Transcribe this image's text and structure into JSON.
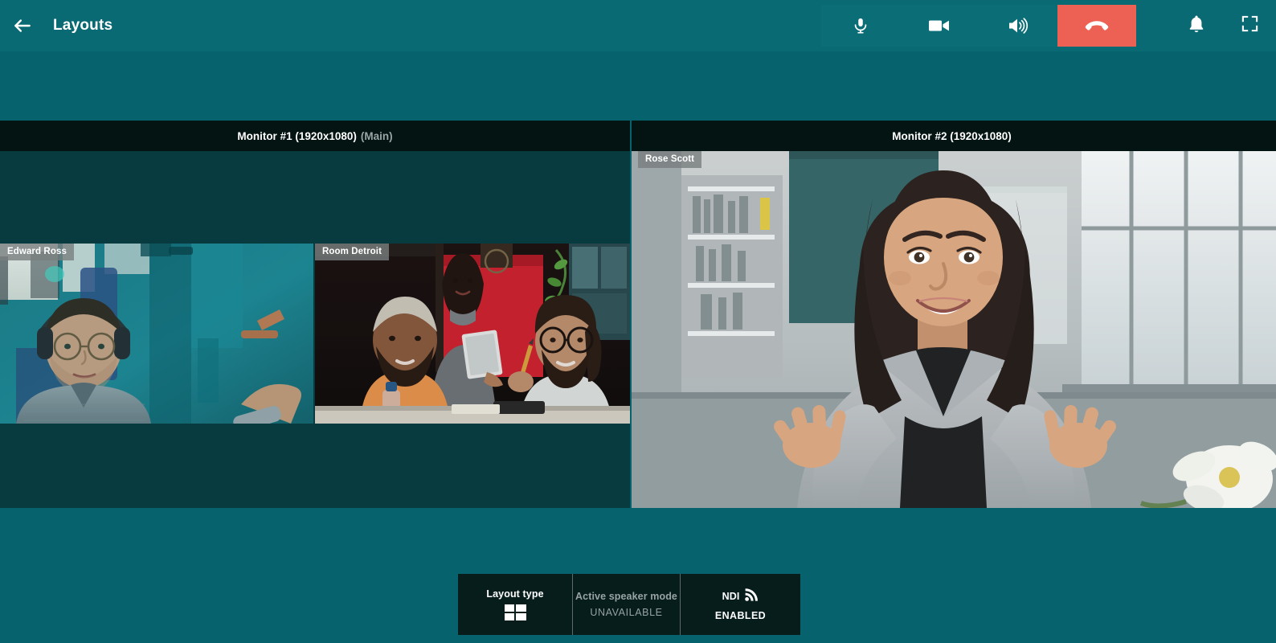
{
  "header": {
    "back_icon": "arrow-left-icon",
    "title": "Layouts",
    "toolbar": [
      {
        "name": "microphone",
        "icon": "microphone-icon",
        "state": "on"
      },
      {
        "name": "camera",
        "icon": "video-camera-icon",
        "state": "on"
      },
      {
        "name": "speaker",
        "icon": "speaker-volume-icon",
        "state": "on"
      },
      {
        "name": "hangup",
        "icon": "phone-hangup-icon",
        "state": "active",
        "color": "#EC6153"
      }
    ],
    "right_icons": [
      {
        "name": "notifications",
        "icon": "bell-icon"
      },
      {
        "name": "fullscreen",
        "icon": "fullscreen-expand-icon"
      }
    ]
  },
  "monitors": [
    {
      "name": "Monitor #1 (1920x1080)",
      "tag": "(Main)",
      "tiles": [
        {
          "label": "Edward Ross"
        },
        {
          "label": "Room Detroit"
        }
      ]
    },
    {
      "name": "Monitor #2 (1920x1080)",
      "tag": "",
      "tiles": [
        {
          "label": "Rose Scott"
        }
      ]
    }
  ],
  "bottom_bar": {
    "layout": {
      "label": "Layout type",
      "icon": "grid-2x2-layout-icon"
    },
    "active_speaker": {
      "label": "Active speaker mode",
      "value": "UNAVAILABLE"
    },
    "ndi": {
      "label": "NDI",
      "icon": "broadcast-signal-icon",
      "value": "ENABLED"
    }
  },
  "colors": {
    "teal_background": "#06636E",
    "header_teal": "#0A6A74",
    "toolbar_teal": "#0B6E77",
    "hangup_red": "#EC6153",
    "monitor_panel": "#073B40",
    "monitor_header": "#041412",
    "bottom_bar": "#061D1C"
  }
}
